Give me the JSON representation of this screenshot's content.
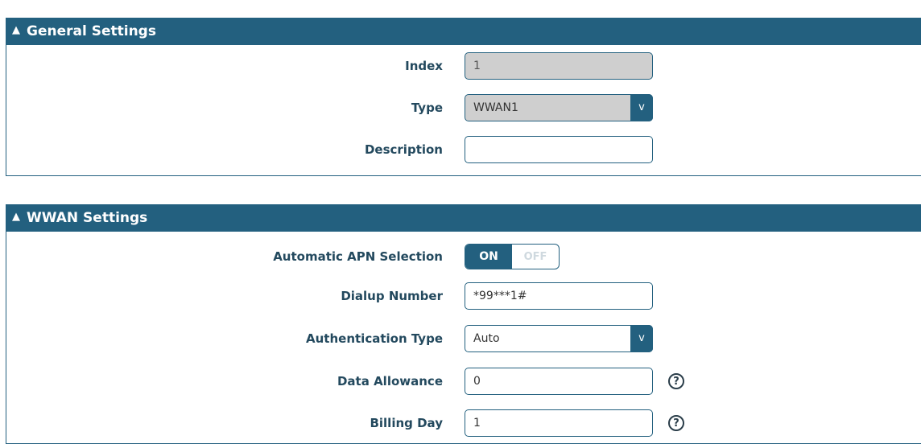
{
  "general": {
    "title": "General Settings",
    "index": {
      "label": "Index",
      "value": "1"
    },
    "type": {
      "label": "Type",
      "value": "WWAN1"
    },
    "description": {
      "label": "Description",
      "value": ""
    }
  },
  "wwan": {
    "title": "WWAN Settings",
    "apn": {
      "label": "Automatic APN Selection",
      "on_label": "ON",
      "off_label": "OFF",
      "state": "on"
    },
    "dialup": {
      "label": "Dialup Number",
      "value": "*99***1#"
    },
    "auth": {
      "label": "Authentication Type",
      "value": "Auto"
    },
    "allowance": {
      "label": "Data Allowance",
      "value": "0"
    },
    "billing": {
      "label": "Billing Day",
      "value": "1"
    }
  },
  "icons": {
    "collapse": "chevron-up-icon",
    "dropdown": "chevron-down-icon",
    "help": "question-circle-icon"
  },
  "colors": {
    "header": "#23607f",
    "label": "#23495e"
  }
}
